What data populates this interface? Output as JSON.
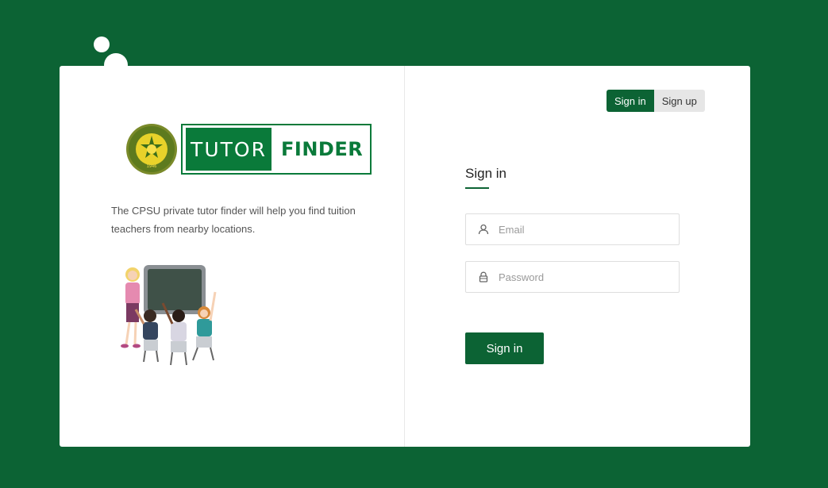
{
  "logo": {
    "seal_text_top": "CENTRAL PHILIPPINES STATE UNIVERSITY",
    "seal_year": "1946",
    "tutor_label": "TUTOR",
    "finder_label": "FINDER"
  },
  "description": "The CPSU private tutor finder will help you find tuition teachers from nearby locations.",
  "toggle": {
    "signin_label": "Sign in",
    "signup_label": "Sign up"
  },
  "form": {
    "title": "Sign in",
    "email_placeholder": "Email",
    "password_placeholder": "Password",
    "submit_label": "Sign in"
  },
  "colors": {
    "background": "#0c6334",
    "brand_green": "#0a7a3a",
    "card": "#ffffff"
  },
  "icons": {
    "email": "user-icon",
    "password": "lock-icon"
  }
}
